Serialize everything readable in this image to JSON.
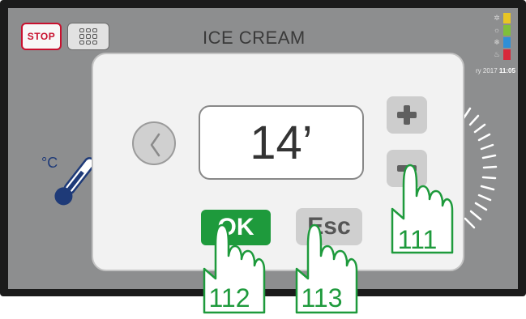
{
  "screen": {
    "title": "ICE CREAM",
    "stop_label": "STOP",
    "datetime_partial": "ry 2017",
    "time": "11:05",
    "status_colors": [
      "#e8c524",
      "#7fbf3a",
      "#2f8fd6",
      "#d8283a"
    ],
    "status_icons": [
      "snowflake-dot-icon",
      "stir-icon",
      "snowflake-icon",
      "heat-icon"
    ],
    "temperature_unit": "°C"
  },
  "dialog": {
    "value": "14’",
    "ok_label": "OK",
    "esc_label": "Esc"
  },
  "callouts": {
    "minus": "111",
    "ok": "112",
    "esc": "113"
  },
  "colors": {
    "stop": "#c8102e",
    "ok": "#1e9a3c",
    "callout": "#1e9a3c",
    "thermometer": "#1e3a78"
  }
}
